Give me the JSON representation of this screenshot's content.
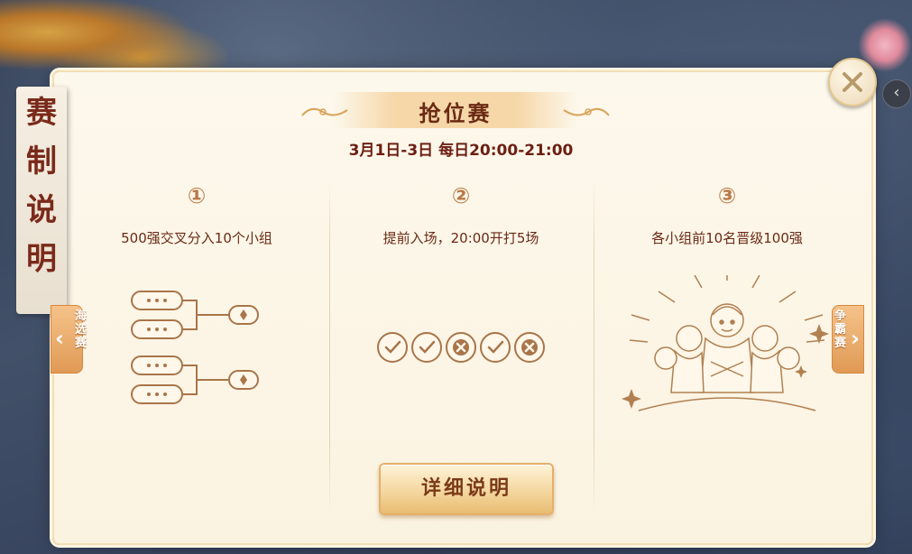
{
  "side_title": [
    "赛",
    "制",
    "说",
    "明"
  ],
  "title": "抢位赛",
  "schedule": "3月1日-3日 每日20:00-21:00",
  "steps": [
    {
      "num": "①",
      "desc": "500强交叉分入10个小组"
    },
    {
      "num": "②",
      "desc": "提前入场，20:00开打5场"
    },
    {
      "num": "③",
      "desc": "各小组前10名晋级100强"
    }
  ],
  "match_results": [
    "win",
    "win",
    "loss",
    "win",
    "loss"
  ],
  "nav": {
    "prev_label": "海选赛",
    "next_label": "争霸赛"
  },
  "detail_button": "详细说明",
  "colors": {
    "accent": "#6b2a14",
    "line": "#a9754a",
    "button": "#f3d49a"
  }
}
